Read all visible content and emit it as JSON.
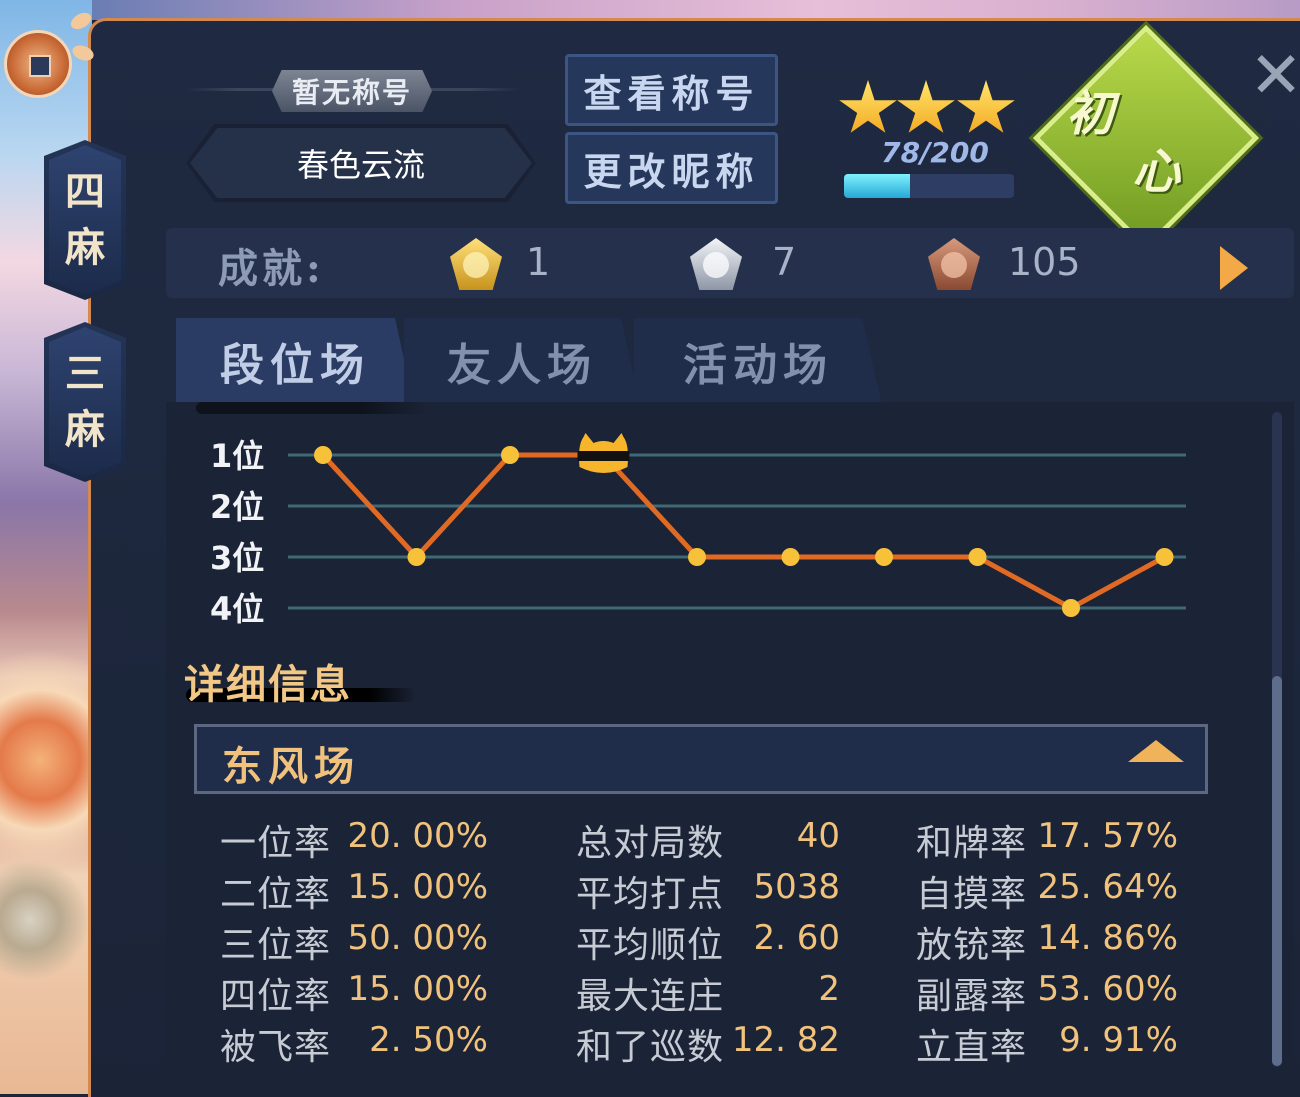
{
  "mode_tabs": [
    "四\n麻",
    "三\n麻"
  ],
  "profile": {
    "title_tag": "暂无称号",
    "nickname": "春色云流",
    "view_title_button": "查看称号",
    "change_nick_button": "更改昵称",
    "star_count": 3,
    "exp_text": "78/200",
    "exp_fraction": 0.39,
    "rank_badge": "初心"
  },
  "achievements": {
    "label": "成就:",
    "gold": "1",
    "silver": "7",
    "bronze": "105"
  },
  "tabs": [
    {
      "label": "段位场",
      "active": true
    },
    {
      "label": "友人场",
      "active": false
    },
    {
      "label": "活动场",
      "active": false
    }
  ],
  "chart_data": {
    "type": "line",
    "y_labels": [
      "1位",
      "2位",
      "3位",
      "4位"
    ],
    "ylim": [
      1,
      4
    ],
    "y_inverted": true,
    "x": [
      1,
      2,
      3,
      4,
      5,
      6,
      7,
      8,
      9,
      10
    ],
    "values": [
      1,
      3,
      1,
      1,
      3,
      3,
      3,
      3,
      4,
      3
    ],
    "line_color": "#e06a24",
    "point_color": "#f7c23a",
    "special_marker_index": 3,
    "special_marker": "cat-with-sunglasses-icon"
  },
  "details": {
    "title": "详细信息",
    "section_title": "东风场",
    "columns": [
      [
        {
          "label": "一位率",
          "value": "20. 00%"
        },
        {
          "label": "二位率",
          "value": "15. 00%"
        },
        {
          "label": "三位率",
          "value": "50. 00%"
        },
        {
          "label": "四位率",
          "value": "15. 00%"
        },
        {
          "label": "被飞率",
          "value": "2. 50%"
        }
      ],
      [
        {
          "label": "总对局数",
          "value": "40"
        },
        {
          "label": "平均打点",
          "value": "5038"
        },
        {
          "label": "平均顺位",
          "value": "2. 60"
        },
        {
          "label": "最大连庄",
          "value": "2"
        },
        {
          "label": "和了巡数",
          "value": "12. 82"
        }
      ],
      [
        {
          "label": "和牌率",
          "value": "17. 57%"
        },
        {
          "label": "自摸率",
          "value": "25. 64%"
        },
        {
          "label": "放铳率",
          "value": "14. 86%"
        },
        {
          "label": "副露率",
          "value": "53. 60%"
        },
        {
          "label": "立直率",
          "value": "9. 91%"
        }
      ]
    ]
  },
  "colors": {
    "accent_orange": "#f1c27c",
    "panel_bg": "#1f2a42"
  }
}
